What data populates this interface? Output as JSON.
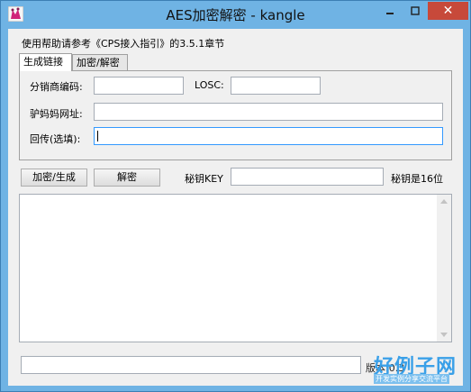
{
  "window": {
    "title": "AES加密解密 - kangle",
    "close_glyph": "✕"
  },
  "help_text": "使用帮助请参考《CPS接入指引》的3.5.1章节",
  "tabs": [
    {
      "label": "生成链接",
      "active": true
    },
    {
      "label": "加密/解密",
      "active": false
    }
  ],
  "form": {
    "distributor_code_label": "分销商编码:",
    "distributor_code_value": "",
    "losc_label": "LOSC:",
    "losc_value": "",
    "url_label": "驴妈妈网址:",
    "url_value": "",
    "callback_label": "回传(选填):",
    "callback_value": ""
  },
  "actions": {
    "encrypt_generate_label": "加密/生成",
    "decrypt_label": "解密",
    "key_label": "秘钥KEY",
    "key_value": "",
    "key_hint": "秘钥是16位"
  },
  "output_text": "",
  "status_text": "",
  "version_text": "版本:0.3",
  "watermark": {
    "main": "好例子网",
    "sub": "开发实例分享交流平台"
  },
  "colors": {
    "frame": "#6fb3e4",
    "close_button": "#c7493a",
    "focus_border": "#3399ff"
  }
}
